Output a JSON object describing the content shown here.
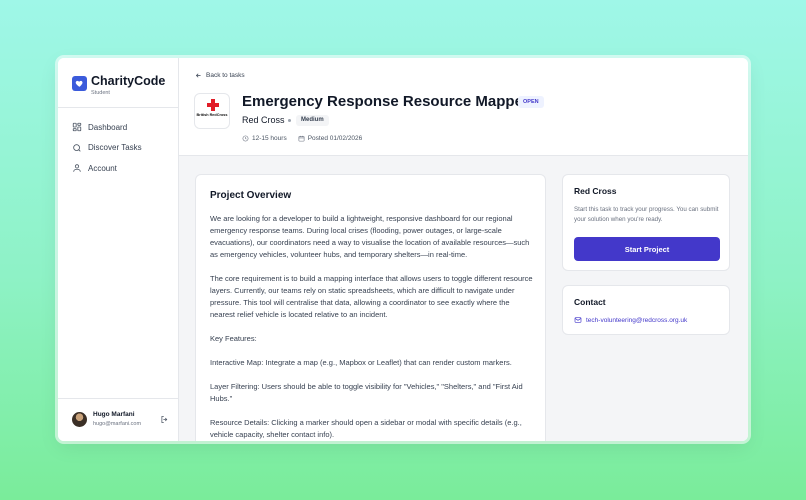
{
  "brand": {
    "name": "CharityCode",
    "subtitle": "Student"
  },
  "nav": [
    {
      "label": "Dashboard",
      "icon": "dashboard-icon"
    },
    {
      "label": "Discover Tasks",
      "icon": "search-icon"
    },
    {
      "label": "Account",
      "icon": "user-icon"
    }
  ],
  "user": {
    "name": "Hugo Marfani",
    "email": "hugo@marfani.com"
  },
  "header": {
    "back_label": "Back to tasks",
    "logo_text": "British RedCross",
    "title": "Emergency Response Resource Mapper",
    "status": "OPEN",
    "org": "Red Cross",
    "level": "Medium",
    "duration": "12-15 hours",
    "posted": "Posted 01/02/2026"
  },
  "overview": {
    "title": "Project Overview",
    "paragraphs": [
      "We are looking for a developer to build a lightweight, responsive dashboard for our regional emergency response teams. During local crises (flooding, power outages, or large-scale evacuations), our coordinators need a way to visualise the location of available resources—such as emergency vehicles, volunteer hubs, and temporary shelters—in real-time.",
      "The core requirement is to build a mapping interface that allows users to toggle different resource layers. Currently, our teams rely on static spreadsheets, which are difficult to navigate under pressure. This tool will centralise that data, allowing a coordinator to see exactly where the nearest relief vehicle is located relative to an incident.",
      "Key Features:",
      "Interactive Map: Integrate a map (e.g., Mapbox or Leaflet) that can render custom markers.",
      "Layer Filtering: Users should be able to toggle visibility for \"Vehicles,\" \"Shelters,\" and \"First Aid Hubs.\"",
      "Resource Details: Clicking a marker should open a sidebar or modal with specific details (e.g., vehicle capacity, shelter contact info)."
    ]
  },
  "task_card": {
    "title": "Red Cross",
    "text": "Start this task to track your progress. You can submit your solution when you're ready.",
    "button": "Start Project"
  },
  "contact": {
    "title": "Contact",
    "email": "tech-volunteering@redcross.org.uk"
  },
  "colors": {
    "accent": "#4338ca",
    "brand": "#3b5bdb",
    "red_cross": "#e11d28"
  }
}
